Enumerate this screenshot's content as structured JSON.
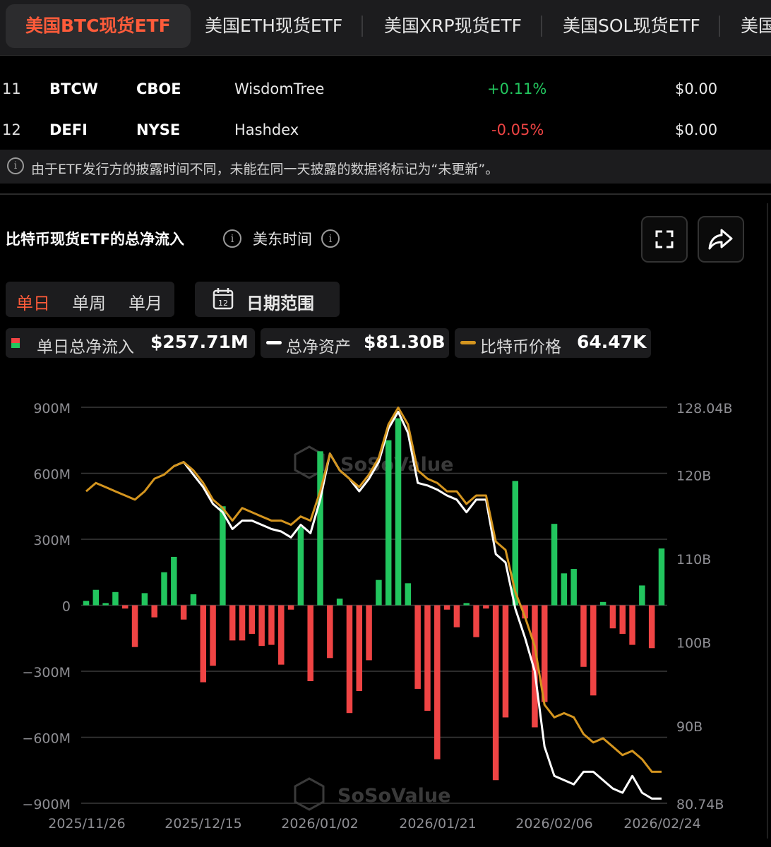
{
  "tabs": [
    {
      "label": "美国BTC现货ETF",
      "active": true
    },
    {
      "label": "美国ETH现货ETF",
      "active": false
    },
    {
      "label": "美国XRP现货ETF",
      "active": false
    },
    {
      "label": "美国SOL现货ETF",
      "active": false
    },
    {
      "label": "美国",
      "active": false
    }
  ],
  "table": {
    "rows": [
      {
        "rank": "11",
        "ticker": "BTCW",
        "exchange": "CBOE",
        "issuer": "WisdomTree",
        "change": "+0.11%",
        "change_color": "#22c55e",
        "value": "$0.00"
      },
      {
        "rank": "12",
        "ticker": "DEFI",
        "exchange": "NYSE",
        "issuer": "Hashdex",
        "change": "-0.05%",
        "change_color": "#ef4444",
        "value": "$0.00"
      }
    ]
  },
  "note": {
    "icon": "info-icon",
    "text": "由于ETF发行方的披露时间不同，未能在同一天披露的数据将标记为“未更新”。"
  },
  "section": {
    "title": "比特币现货ETF的总净流入",
    "timezone": "美东时间",
    "fullscreen_icon": "fullscreen-icon",
    "share_icon": "share-icon"
  },
  "period": {
    "options": [
      "单日",
      "单周",
      "单月"
    ],
    "selected": "单日"
  },
  "date_range": {
    "label": "日期范围",
    "icon": "calendar-icon",
    "icon_text": "12"
  },
  "legend": [
    {
      "label": "单日总净流入",
      "value": "$257.71M",
      "color": "#22c55e"
    },
    {
      "label": "总净资产",
      "value": "$81.30B",
      "color": "#ffffff"
    },
    {
      "label": "比特币价格",
      "value": "64.47K",
      "color": "#d4951f"
    }
  ],
  "chart_data": {
    "type": "bar",
    "title": "比特币现货ETF的总净流入",
    "y_left": {
      "ticks": [
        "900M",
        "600M",
        "300M",
        "0",
        "−300M",
        "−600M",
        "−900M"
      ],
      "range": [
        -900,
        900
      ],
      "unit": "M USD"
    },
    "y_right": {
      "ticks": [
        "128.04B",
        "120B",
        "110B",
        "100B",
        "90B",
        "80.74B"
      ],
      "range": [
        80.74,
        128.04
      ],
      "unit": "B USD"
    },
    "x_ticks": [
      "2025/11/26",
      "2025/12/15",
      "2026/01/02",
      "2026/01/21",
      "2026/02/06",
      "2026/02/24"
    ],
    "grid": true,
    "watermark": "SoSoValue",
    "colors": {
      "positive": "#22c55e",
      "negative": "#ef4444",
      "assets": "#ffffff",
      "price": "#d4951f",
      "grid": "#3a3a3a",
      "axis_text": "#8e8e93"
    },
    "series": [
      {
        "name": "单日总净流入",
        "type": "bar",
        "values": [
          20,
          70,
          10,
          60,
          -15,
          -190,
          55,
          -55,
          150,
          220,
          -65,
          50,
          -350,
          -275,
          450,
          -160,
          -160,
          -130,
          -185,
          -180,
          -270,
          -20,
          355,
          -345,
          700,
          -240,
          30,
          -490,
          -390,
          -250,
          115,
          750,
          850,
          100,
          -380,
          -480,
          -700,
          -20,
          -100,
          10,
          -145,
          -15,
          -795,
          -510,
          565,
          -60,
          -555,
          -440,
          370,
          145,
          165,
          -280,
          -410,
          15,
          -105,
          -130,
          -180,
          90,
          -195,
          258
        ]
      },
      {
        "name": "总净资产",
        "type": "line",
        "values": [
          null,
          null,
          null,
          null,
          null,
          null,
          null,
          null,
          null,
          121,
          121.5,
          120,
          118.5,
          116.5,
          115.5,
          113.5,
          114.5,
          114.5,
          114,
          113.5,
          113.2,
          112.5,
          114,
          113,
          117,
          122.5,
          120.5,
          119.5,
          118,
          119.5,
          121.5,
          125.5,
          127.5,
          125,
          119,
          118.7,
          118.2,
          117.5,
          117,
          115.5,
          117,
          117,
          110.5,
          109.5,
          104,
          100.5,
          96.5,
          87.5,
          84,
          83.5,
          83,
          84.5,
          84.5,
          83.5,
          82.5,
          82,
          84,
          82,
          81.3,
          81.3
        ]
      },
      {
        "name": "比特币价格",
        "type": "line",
        "values": [
          118,
          119,
          118.5,
          118,
          117.5,
          117,
          118,
          119.5,
          120,
          121,
          121.5,
          120.5,
          119,
          117,
          116,
          114.5,
          116,
          115.5,
          115,
          114.5,
          114.5,
          114,
          115,
          114.5,
          118,
          122.5,
          120.5,
          119.5,
          118.5,
          120,
          122,
          126,
          128,
          126,
          120.5,
          119.5,
          119,
          118,
          118,
          116.5,
          117.5,
          117.5,
          112,
          111,
          106,
          103,
          99.5,
          92.5,
          91,
          91.5,
          91,
          89,
          88,
          88.5,
          87.5,
          86.5,
          87,
          86,
          84.5,
          84.5
        ]
      }
    ]
  }
}
